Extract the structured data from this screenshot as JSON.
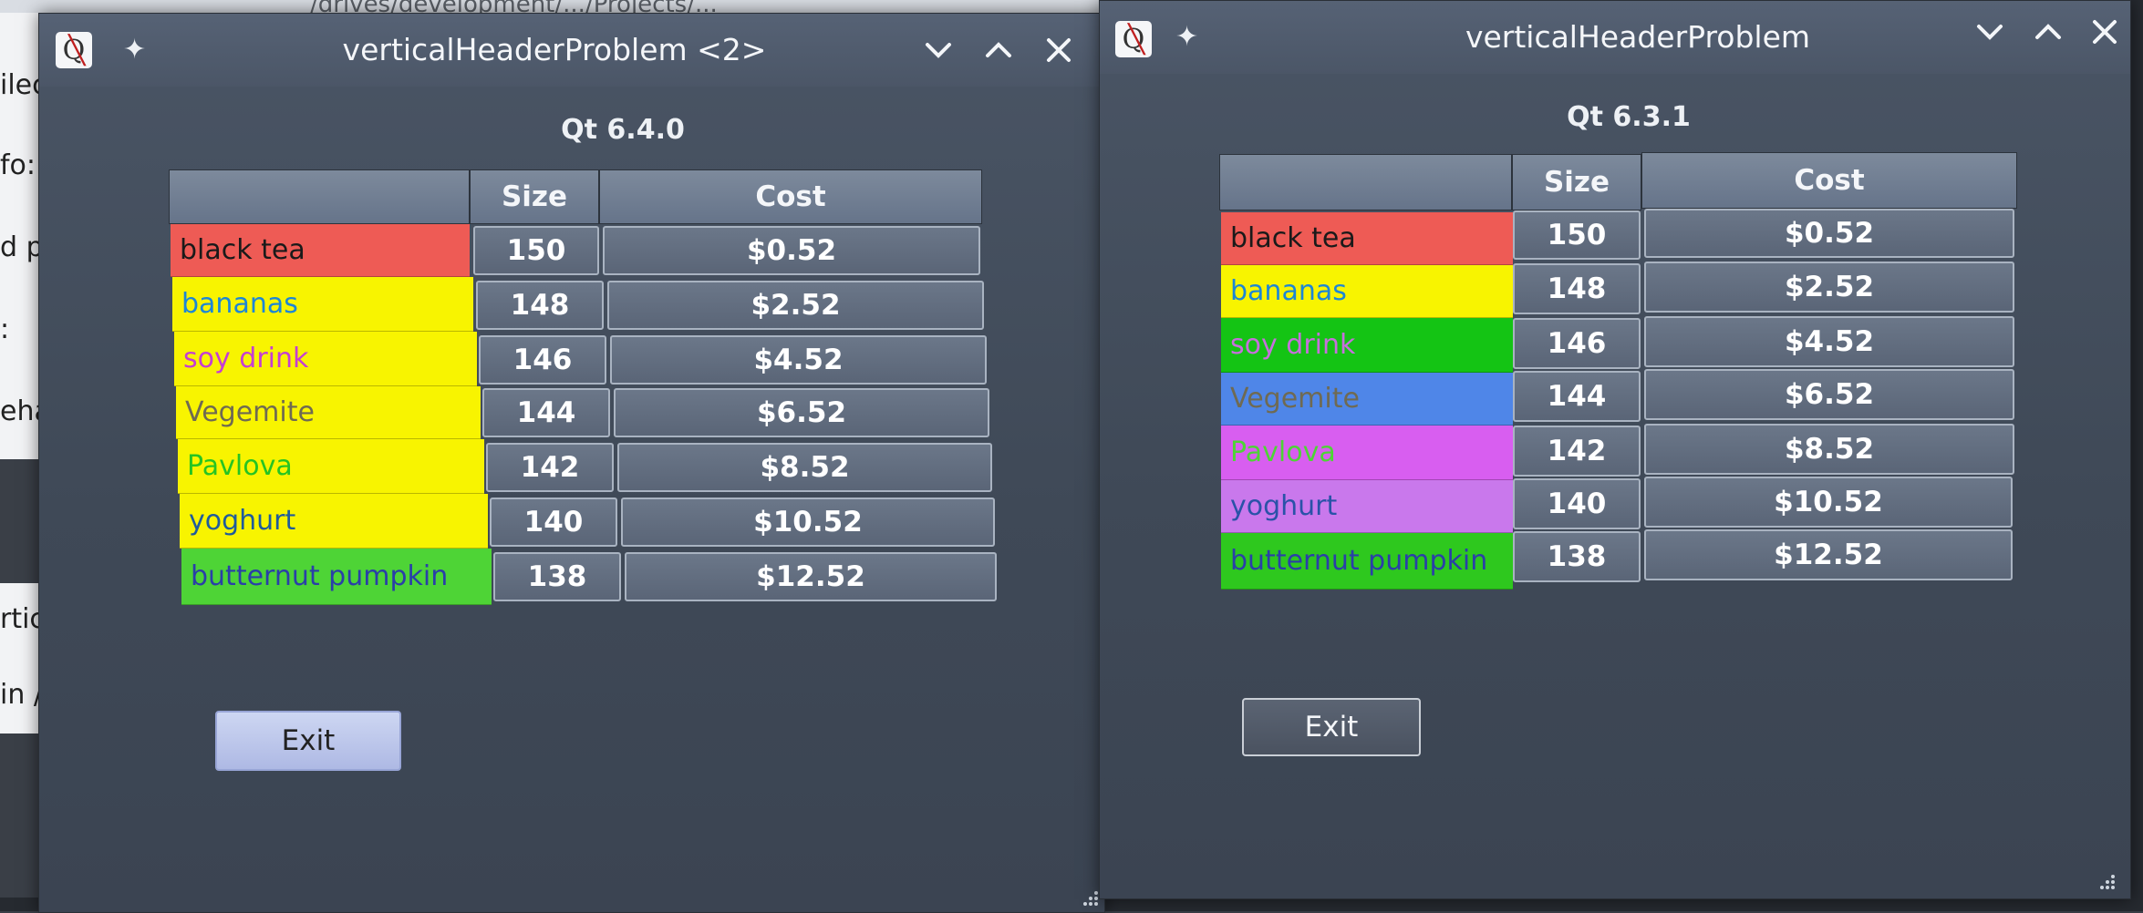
{
  "background": {
    "path_fragment": "/drives/development/.../Projects/...",
    "left_fragments": [
      "ilec",
      "fo:",
      "d pr",
      ":",
      "ehav",
      "rtica",
      "in /c"
    ]
  },
  "windows": [
    {
      "title": "verticalHeaderProblem <2>",
      "version_label": "Qt 6.4.0",
      "headers": [
        "Size",
        "Cost"
      ],
      "rows": [
        {
          "label": "black tea",
          "size": "150",
          "cost": "$0.52",
          "bg": "#ee5b55",
          "fg": "#1a1a1a"
        },
        {
          "label": "bananas",
          "size": "148",
          "cost": "$2.52",
          "bg": "#f8f400",
          "fg": "#1d86d6"
        },
        {
          "label": "soy drink",
          "size": "146",
          "cost": "$4.52",
          "bg": "#f8f400",
          "fg": "#c53ed3"
        },
        {
          "label": "Vegemite",
          "size": "144",
          "cost": "$6.52",
          "bg": "#f8f400",
          "fg": "#6f6a52"
        },
        {
          "label": "Pavlova",
          "size": "142",
          "cost": "$8.52",
          "bg": "#f8f400",
          "fg": "#26c422"
        },
        {
          "label": "yoghurt",
          "size": "140",
          "cost": "$10.52",
          "bg": "#f8f400",
          "fg": "#1f5b9c"
        },
        {
          "label": "butternut pumpkin",
          "size": "138",
          "cost": "$12.52",
          "bg": "#4ed436",
          "fg": "#2a3fa8"
        }
      ],
      "exit_label": "Exit"
    },
    {
      "title": "verticalHeaderProblem",
      "version_label": "Qt 6.3.1",
      "headers": [
        "Size",
        "Cost"
      ],
      "rows": [
        {
          "label": "black tea",
          "size": "150",
          "cost": "$0.52",
          "bg": "#ee5b55",
          "fg": "#1a1a1a"
        },
        {
          "label": "bananas",
          "size": "148",
          "cost": "$2.52",
          "bg": "#f8f400",
          "fg": "#1d86d6"
        },
        {
          "label": "soy drink",
          "size": "146",
          "cost": "$4.52",
          "bg": "#14c414",
          "fg": "#c76fdc"
        },
        {
          "label": "Vegemite",
          "size": "144",
          "cost": "$6.52",
          "bg": "#4f86e8",
          "fg": "#6f6a52"
        },
        {
          "label": "Pavlova",
          "size": "142",
          "cost": "$8.52",
          "bg": "#d85ef0",
          "fg": "#4ed436"
        },
        {
          "label": "yoghurt",
          "size": "140",
          "cost": "$10.52",
          "bg": "#c978ec",
          "fg": "#2a52a8"
        },
        {
          "label": "butternut pumpkin",
          "size": "138",
          "cost": "$12.52",
          "bg": "#2ec81e",
          "fg": "#2a3fa8"
        }
      ],
      "exit_label": "Exit"
    }
  ]
}
